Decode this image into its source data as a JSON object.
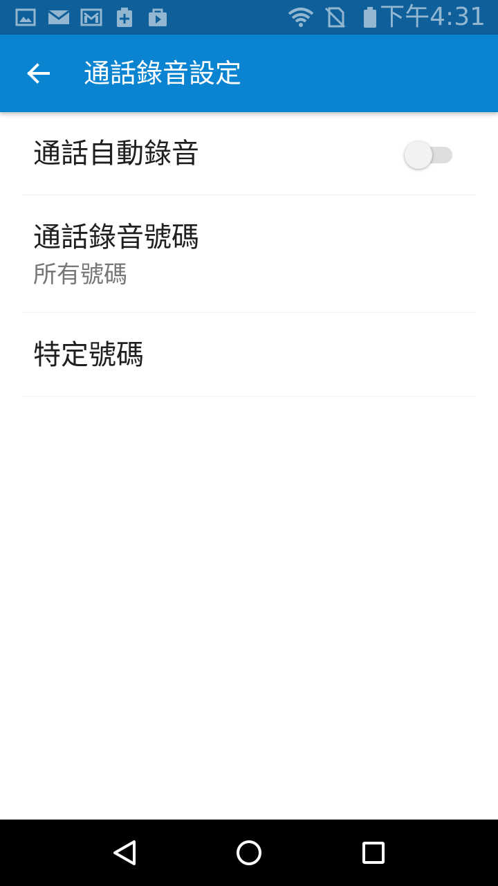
{
  "status_bar": {
    "time": "下午4:31",
    "left_icons": [
      "gallery-icon",
      "mail-icon",
      "gmail-icon",
      "battery-saver-icon",
      "play-store-icon"
    ],
    "right_icons": [
      "wifi-icon",
      "no-sim-icon",
      "battery-icon"
    ]
  },
  "app_bar": {
    "title": "通話錄音設定",
    "back_icon": "arrow-back-icon",
    "color": "#0a84d0"
  },
  "settings": {
    "auto_record": {
      "title": "通話自動錄音",
      "enabled": false
    },
    "record_numbers": {
      "title": "通話錄音號碼",
      "summary": "所有號碼"
    },
    "specific_numbers": {
      "title": "特定號碼"
    }
  },
  "nav_bar": {
    "icons": [
      "back-triangle-icon",
      "home-circle-icon",
      "recents-square-icon"
    ]
  }
}
